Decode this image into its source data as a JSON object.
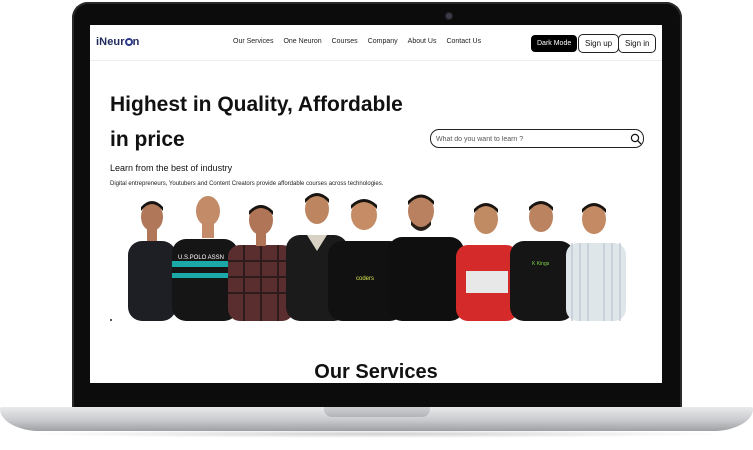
{
  "brand": {
    "logo_text_a": "iNeur",
    "logo_text_b": "n"
  },
  "nav": {
    "links": [
      "Our Services",
      "One Neuron",
      "Courses",
      "Company",
      "About Us",
      "Contact Us"
    ],
    "dark_mode_label": "Dark Mode",
    "signup_label": "Sign up",
    "signin_label": "Sign in"
  },
  "hero": {
    "title_line1": "Highest in Quality, Affordable",
    "title_line2": "in price",
    "subtitle": "Learn from the best of industry",
    "description": "Digital entrepreneurs, Youtubers and Content Creators provide affordable courses across technologies.",
    "shirt_text_1": "U.S.POLO ASSN",
    "shirt_text_2": "coders",
    "shirt_text_3": "K Kings"
  },
  "search": {
    "placeholder": "What do you want to learn ?"
  },
  "services": {
    "heading": "Our Services"
  },
  "colors": {
    "accent": "#2c3b8f",
    "text": "#111111",
    "button_dark": "#000000"
  }
}
